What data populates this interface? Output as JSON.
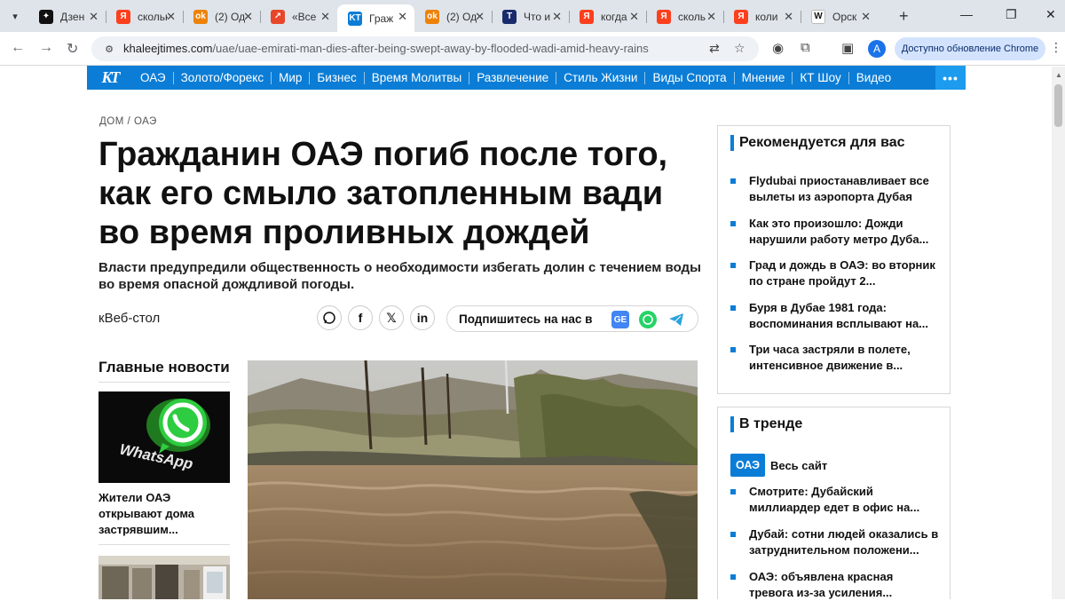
{
  "browser": {
    "tabs": [
      {
        "title": "Дзен",
        "favicon": "dzen-icon",
        "color": "#111111",
        "glyph": "✦"
      },
      {
        "title": "скольк",
        "favicon": "yandex-icon",
        "color": "#fc3f1d",
        "glyph": "Я"
      },
      {
        "title": "(2) Од",
        "favicon": "ok-icon",
        "color": "#ee8208",
        "glyph": "ok"
      },
      {
        "title": "«Все",
        "favicon": "news-icon",
        "color": "#e8462a",
        "glyph": "↗"
      },
      {
        "title": "Граж",
        "favicon": "khaleej-icon",
        "color": "#0b7dd6",
        "glyph": "KT",
        "active": true
      },
      {
        "title": "(2) Од",
        "favicon": "ok-icon",
        "color": "#ee8208",
        "glyph": "ok"
      },
      {
        "title": "Что и",
        "favicon": "t-icon",
        "color": "#1a2b6d",
        "glyph": "T"
      },
      {
        "title": "когда",
        "favicon": "yandex-icon",
        "color": "#fc3f1d",
        "glyph": "Я"
      },
      {
        "title": "сколь",
        "favicon": "yandex-icon",
        "color": "#fc3f1d",
        "glyph": "Я"
      },
      {
        "title": "коли",
        "favicon": "yandex-icon",
        "color": "#fc3f1d",
        "glyph": "Я"
      },
      {
        "title": "Орск",
        "favicon": "wikipedia-icon",
        "color": "#ffffff",
        "glyph": "W"
      }
    ],
    "url_host": "khaleejtimes.com",
    "url_path": "/uae/uae-emirati-man-dies-after-being-swept-away-by-flooded-wadi-amid-heavy-rains",
    "update_label": "Доступно обновление Chrome",
    "avatar_letter": "A"
  },
  "site": {
    "brand_color": "#0b7dd6",
    "logo_text": "KT",
    "nav": [
      "ОАЭ",
      "Золото/Форекс",
      "Мир",
      "Бизнес",
      "Время Молитвы",
      "Развлечение",
      "Стиль Жизни",
      "Виды Спорта",
      "Мнение",
      "КТ Шоу",
      "Видео"
    ]
  },
  "article": {
    "breadcrumb_home": "ДОМ",
    "breadcrumb_sep": "/",
    "breadcrumb_section": "ОАЭ",
    "headline": "Гражданин ОАЭ погиб после того, как его смыло затопленным вади во время проливных дождей",
    "subheadline": "Власти предупредили общественность о необходимости избегать долин с течением воды во время опасной дождливой погоды.",
    "author": "кВеб-стол",
    "follow_label": "Подпишитесь на нас в"
  },
  "top_news": {
    "title": "Главные новости",
    "items": [
      {
        "caption": "Жители ОАЭ открывают дома застрявшим...",
        "thumb_text": "WhatsApp"
      }
    ]
  },
  "recommended": {
    "title": "Рекомендуется для вас",
    "items": [
      "Flydubai приостанавливает все вылеты из аэропорта Дубая",
      "Как это произошло: Дожди нарушили работу метро Дуба...",
      "Град и дождь в ОАЭ: во вторник по стране пройдут 2...",
      "Буря в Дубае 1981 года: воспоминания всплывают на...",
      "Три часа застряли в полете, интенсивное движение в..."
    ]
  },
  "trending": {
    "title": "В тренде",
    "tag": "ОАЭ",
    "all_site": "Весь сайт",
    "items": [
      "Смотрите: Дубайский миллиардер едет в офис на...",
      "Дубай: сотни людей оказались в затруднительном положени...",
      "ОАЭ: объявлена красная тревога из-за усиления..."
    ]
  }
}
